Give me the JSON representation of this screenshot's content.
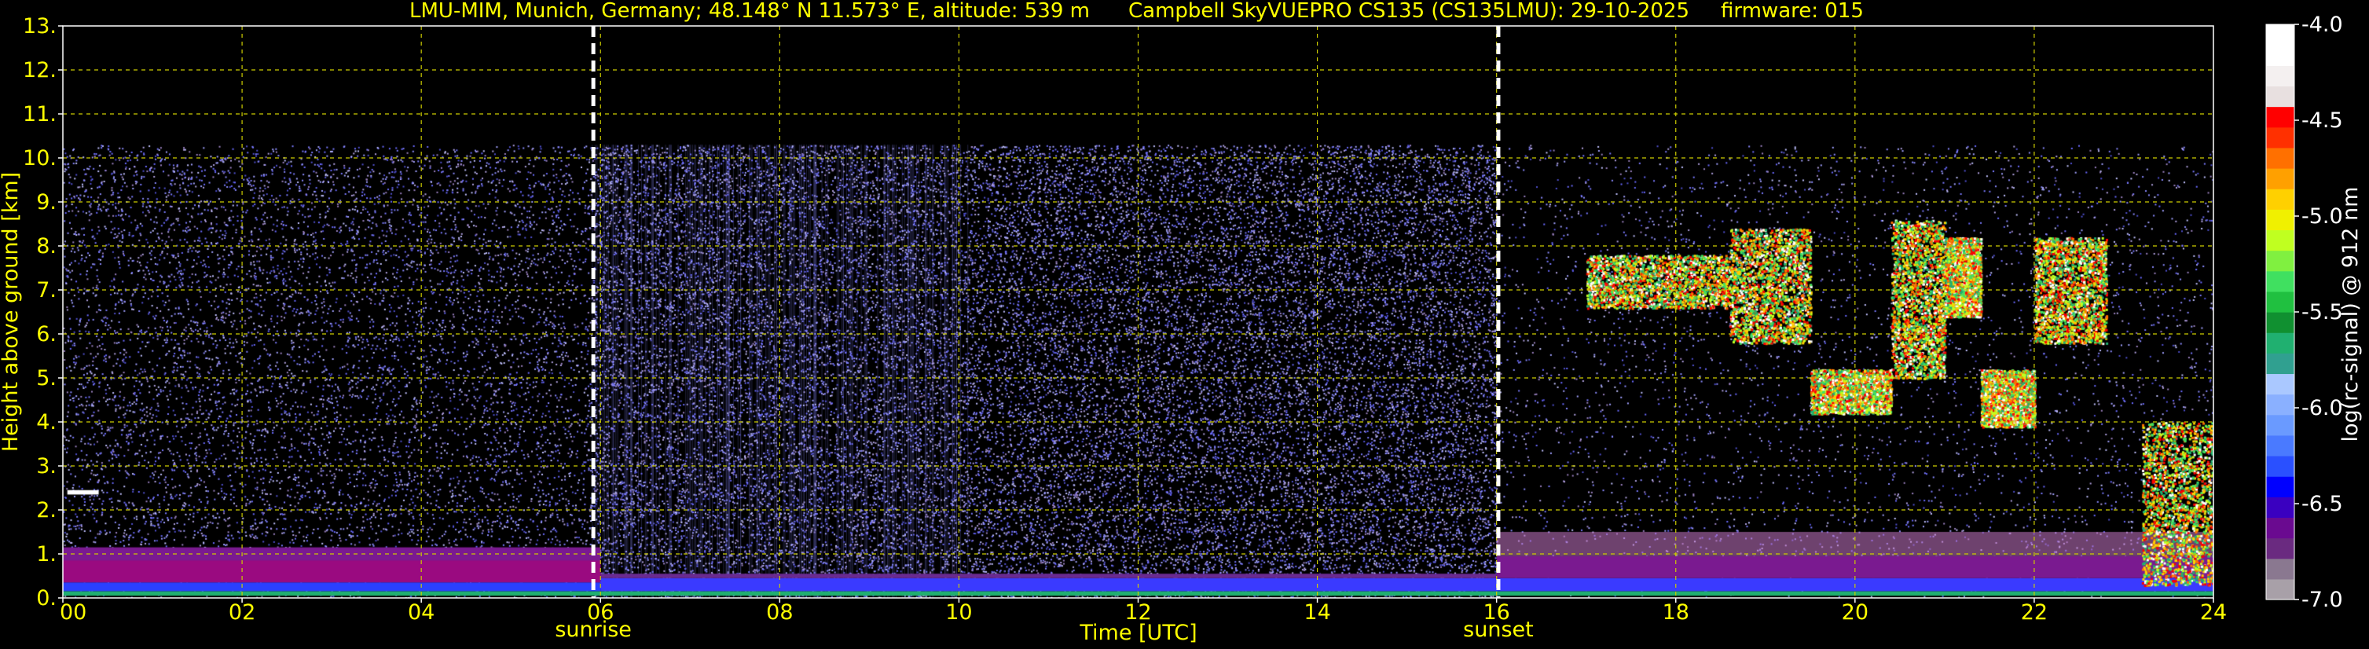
{
  "chart_data": {
    "type": "heatmap",
    "title_left": "LMU-MIM, Munich, Germany; 48.148° N 11.573° E, altitude: 539 m",
    "title_mid": "Campbell SkyVUEPRO CS135 (CS135LMU): 29-10-2025",
    "title_right": "firmware: 015",
    "xlabel": "Time [UTC]",
    "ylabel": "Height above ground [km]",
    "colorbar_label": "log(rc-signal) @ 912 nm",
    "x_ticks": [
      "00",
      "02",
      "04",
      "06",
      "08",
      "10",
      "12",
      "14",
      "16",
      "18",
      "20",
      "22",
      "24"
    ],
    "y_ticks": [
      "0.",
      "1.",
      "2.",
      "3.",
      "4.",
      "5.",
      "6.",
      "7.",
      "8.",
      "9.",
      "10.",
      "11.",
      "12.",
      "13."
    ],
    "xlim": [
      0,
      24
    ],
    "ylim": [
      0,
      13
    ],
    "grid": true,
    "colorbar": {
      "range": [
        -7.0,
        -4.0
      ],
      "ticks": [
        "-4.0",
        "-4.5",
        "-5.0",
        "-5.5",
        "-6.0",
        "-6.5",
        "-7.0"
      ],
      "tick_values": [
        -4.0,
        -4.5,
        -5.0,
        -5.5,
        -6.0,
        -6.5,
        -7.0
      ],
      "colors": [
        "#a8a0a8",
        "#8a7890",
        "#6a2a80",
        "#6a0a90",
        "#3a00c0",
        "#0000ff",
        "#2a50ff",
        "#4a7aff",
        "#6a9aff",
        "#8ab0ff",
        "#aac8ff",
        "#30a090",
        "#20b070",
        "#109030",
        "#20c040",
        "#40e060",
        "#80f040",
        "#c0ff20",
        "#f0f000",
        "#ffd000",
        "#ffa000",
        "#ff7000",
        "#ff3000",
        "#ff0000",
        "#e8e0e0",
        "#f4f0f0",
        "#ffffff",
        "#ffffff"
      ]
    },
    "markers": [
      {
        "label": "sunrise",
        "time": 5.92
      },
      {
        "label": "sunset",
        "time": 16.02
      }
    ],
    "noise_top_km": 10.3,
    "cloud_layers": [
      {
        "t_start": 17.0,
        "t_end": 18.6,
        "base_km": 6.6,
        "top_km": 7.8
      },
      {
        "t_start": 18.6,
        "t_end": 19.5,
        "base_km": 5.8,
        "top_km": 8.4
      },
      {
        "t_start": 19.5,
        "t_end": 20.4,
        "base_km": 4.2,
        "top_km": 5.2
      },
      {
        "t_start": 20.4,
        "t_end": 21.0,
        "base_km": 5.0,
        "top_km": 8.6
      },
      {
        "t_start": 21.0,
        "t_end": 21.4,
        "base_km": 6.4,
        "top_km": 8.2
      },
      {
        "t_start": 21.4,
        "t_end": 22.0,
        "base_km": 3.9,
        "top_km": 5.2
      },
      {
        "t_start": 22.0,
        "t_end": 22.8,
        "base_km": 5.8,
        "top_km": 8.2
      },
      {
        "t_start": 23.2,
        "t_end": 24.0,
        "base_km": 0.3,
        "top_km": 4.0
      }
    ]
  }
}
